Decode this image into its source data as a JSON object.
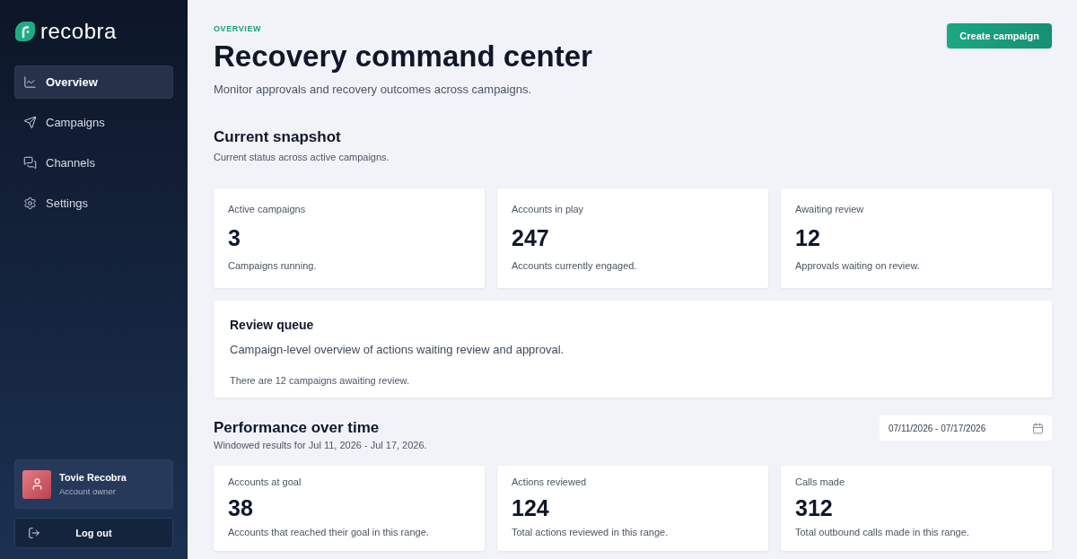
{
  "sidebar": {
    "logo": {
      "text": "recobra"
    },
    "nav_items": [
      {
        "label": "Overview",
        "selected": true
      },
      {
        "label": "Campaigns",
        "selected": false
      },
      {
        "label": "Channels",
        "selected": false
      },
      {
        "label": "Settings",
        "selected": false
      }
    ],
    "user": {
      "name": "Tovie Recobra",
      "role": "Account owner"
    },
    "logout": {
      "label": "Log out"
    }
  },
  "header": {
    "eyebrow": "OVERVIEW",
    "title": "Recovery command center",
    "subtitle": "Monitor approvals and recovery outcomes across campaigns.",
    "primary_action": {
      "label": "Create campaign"
    }
  },
  "snapshot": {
    "title": "Current snapshot",
    "subtitle": "Current status across active campaigns.",
    "cards": [
      {
        "label": "Active campaigns",
        "value": "3",
        "description": "Campaigns running."
      },
      {
        "label": "Accounts in play",
        "value": "247",
        "description": "Accounts currently engaged."
      },
      {
        "label": "Awaiting review",
        "value": "12",
        "description": "Approvals waiting on review."
      }
    ]
  },
  "review_queue": {
    "title": "Review queue",
    "description": "Campaign-level overview of actions waiting review and approval.",
    "note": "There are 12 campaigns awaiting review."
  },
  "performance": {
    "title": "Performance over time",
    "subtitle": "Windowed results for Jul 11, 2026 - Jul 17, 2026.",
    "date_range": {
      "value": "07/11/2026 - 07/17/2026"
    },
    "cards": [
      {
        "label": "Accounts at goal",
        "value": "38",
        "description": "Accounts that reached their goal in this range."
      },
      {
        "label": "Actions reviewed",
        "value": "124",
        "description": "Total actions reviewed in this range."
      },
      {
        "label": "Calls made",
        "value": "312",
        "description": "Total outbound calls made in this range."
      }
    ]
  }
}
